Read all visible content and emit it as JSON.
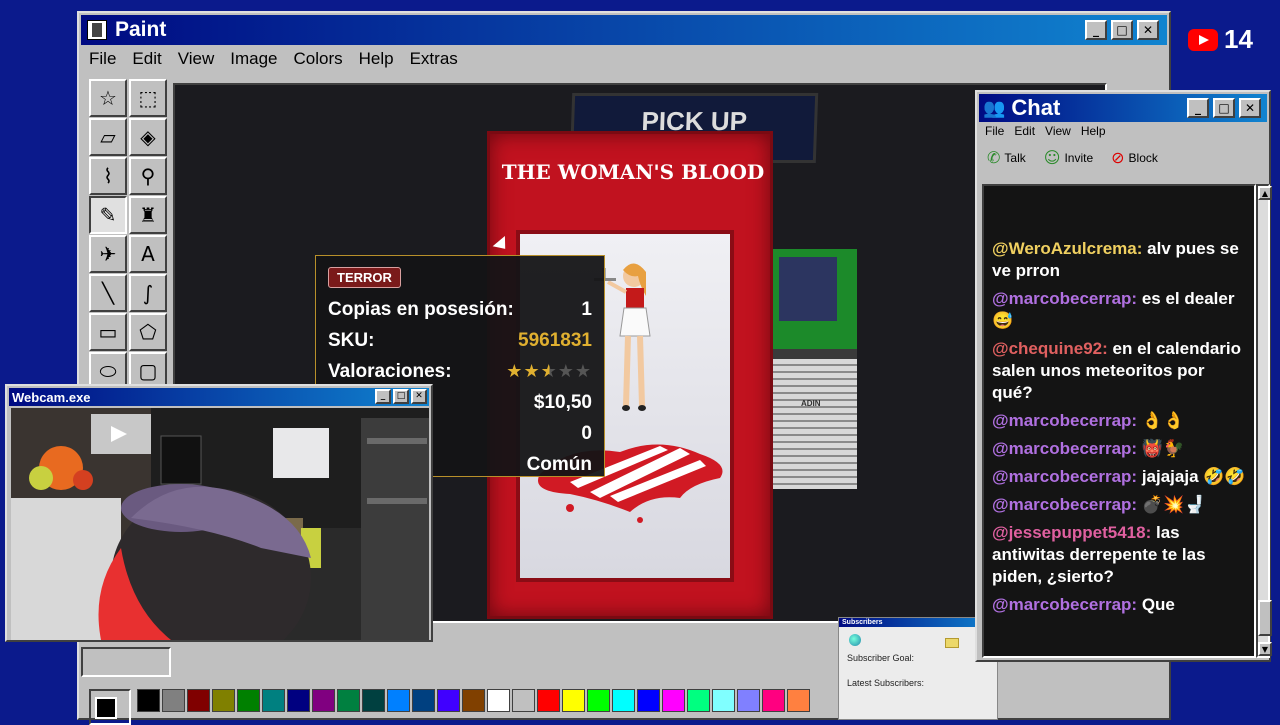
{
  "youtube": {
    "count": "14"
  },
  "paint": {
    "title": "Paint",
    "menu": [
      "File",
      "Edit",
      "View",
      "Image",
      "Colors",
      "Help",
      "Extras"
    ],
    "tools": [
      "free-select-icon",
      "rect-select-icon",
      "eraser-icon",
      "fill-icon",
      "eyedropper-icon",
      "magnifier-icon",
      "pencil-icon",
      "brush-icon",
      "airbrush-icon",
      "text-icon",
      "line-icon",
      "curve-icon",
      "rectangle-icon",
      "polygon-icon",
      "ellipse-icon",
      "rounded-rect-icon"
    ],
    "palette": [
      "#000000",
      "#808080",
      "#800000",
      "#808000",
      "#008000",
      "#008080",
      "#000080",
      "#800080",
      "#008040",
      "#004040",
      "#0080ff",
      "#004080",
      "#4000ff",
      "#804000",
      "#ffffff",
      "#c0c0c0",
      "#ff0000",
      "#ffff00",
      "#00ff00",
      "#00ffff",
      "#0000ff",
      "#ff00ff",
      "#00ff80",
      "#80ffff",
      "#8080ff",
      "#ff0080",
      "#ff8040"
    ]
  },
  "scene": {
    "sign": "PICK UP",
    "book_title": "THE WOMAN'S BLOOD",
    "stack_label": "ADIN"
  },
  "card": {
    "genre": "TERROR",
    "rows": [
      {
        "label": "Copias en posesión:",
        "value": "1"
      },
      {
        "label": "SKU:",
        "value": "5961831"
      },
      {
        "label": "Valoraciones:",
        "value": ""
      },
      {
        "label": "",
        "value": "$10,50"
      },
      {
        "label": "",
        "value": "0"
      },
      {
        "label": "",
        "value": "Común"
      }
    ],
    "rating": 2.5
  },
  "webcam": {
    "title": "Webcam.exe"
  },
  "chat": {
    "title": "Chat",
    "menu": [
      "File",
      "Edit",
      "View",
      "Help"
    ],
    "toolbar": [
      {
        "label": "Talk",
        "icon": "talk-icon"
      },
      {
        "label": "Invite",
        "icon": "invite-icon"
      },
      {
        "label": "Block",
        "icon": "block-icon"
      }
    ],
    "messages": [
      {
        "user": "@WeroAzulcrema:",
        "text": "alv pues se ve prron",
        "color": "#f0d060"
      },
      {
        "user": "@marcobecerrap:",
        "text": "es el dealer 😅",
        "color": "#b070e0"
      },
      {
        "user": "@chequine92:",
        "text": "en el calendario salen unos meteoritos por qué?",
        "color": "#e06060"
      },
      {
        "user": "@marcobecerrap:",
        "text": "👌👌",
        "color": "#b070e0"
      },
      {
        "user": "@marcobecerrap:",
        "text": "👹🐓",
        "color": "#b070e0"
      },
      {
        "user": "@marcobecerrap:",
        "text": "jajajaja 🤣🤣",
        "color": "#b070e0"
      },
      {
        "user": "@marcobecerrap:",
        "text": "💣💥🚽",
        "color": "#b070e0"
      },
      {
        "user": "@jessepuppet5418:",
        "text": "las antiwitas derrepente te las piden, ¿sierto?",
        "color": "#e060a0"
      },
      {
        "user": "@marcobecerrap:",
        "text": "Que",
        "color": "#b070e0"
      }
    ]
  },
  "subs": {
    "title": "Subscribers",
    "goal": "Subscriber Goal:",
    "latest": "Latest Subscribers:"
  }
}
